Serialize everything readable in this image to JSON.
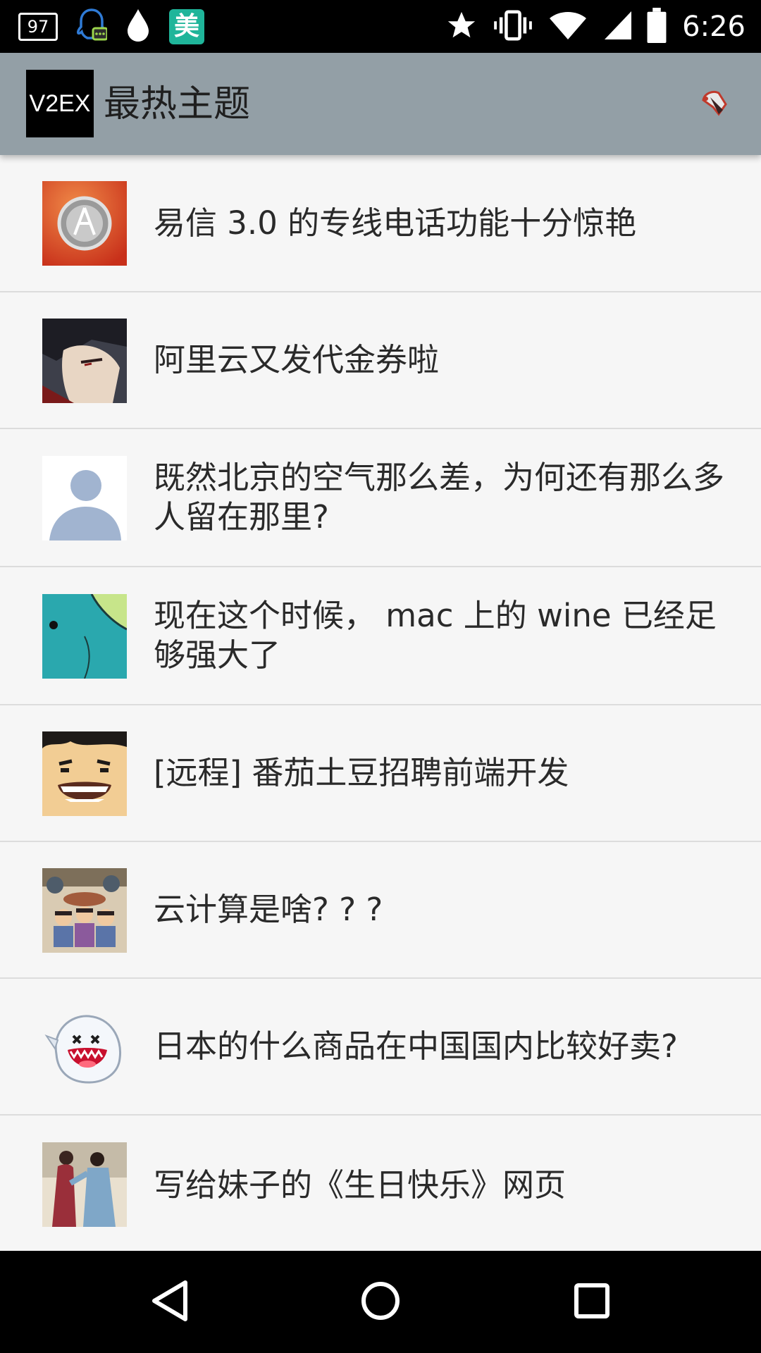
{
  "status_bar": {
    "notification_badge": "97",
    "mei_label": "美",
    "time": "6:26",
    "icons": [
      "qq-icon",
      "drop-icon",
      "mei-app-icon",
      "star-icon",
      "vibrate-icon",
      "wifi-icon",
      "signal-icon",
      "battery-icon"
    ]
  },
  "app_bar": {
    "logo_text": "V2EX",
    "title": "最热主题",
    "action_icon": "hands-icon",
    "background": "#939fa6"
  },
  "topics": [
    {
      "title": "易信 3.0 的专线电话功能十分惊艳",
      "avatar": "audio-technica-avatar"
    },
    {
      "title": "阿里云又发代金券啦",
      "avatar": "anime-character-avatar"
    },
    {
      "title": "既然北京的空气那么差，为何还有那么多人留在那里?",
      "avatar": "default-person-avatar"
    },
    {
      "title": "现在这个时候， mac 上的 wine 已经足够强大了",
      "avatar": "teal-cartoon-avatar"
    },
    {
      "title": "[远程] 番茄土豆招聘前端开发",
      "avatar": "grinning-face-avatar"
    },
    {
      "title": "云计算是啥? ? ?",
      "avatar": "cartoon-group-avatar"
    },
    {
      "title": "日本的什么商品在中国国内比较好卖?",
      "avatar": "boo-ghost-avatar"
    },
    {
      "title": "写给妹子的《生日快乐》网页",
      "avatar": "couple-photo-avatar"
    }
  ],
  "nav_bar": {
    "buttons": [
      "back-icon",
      "home-icon",
      "recents-icon"
    ]
  }
}
